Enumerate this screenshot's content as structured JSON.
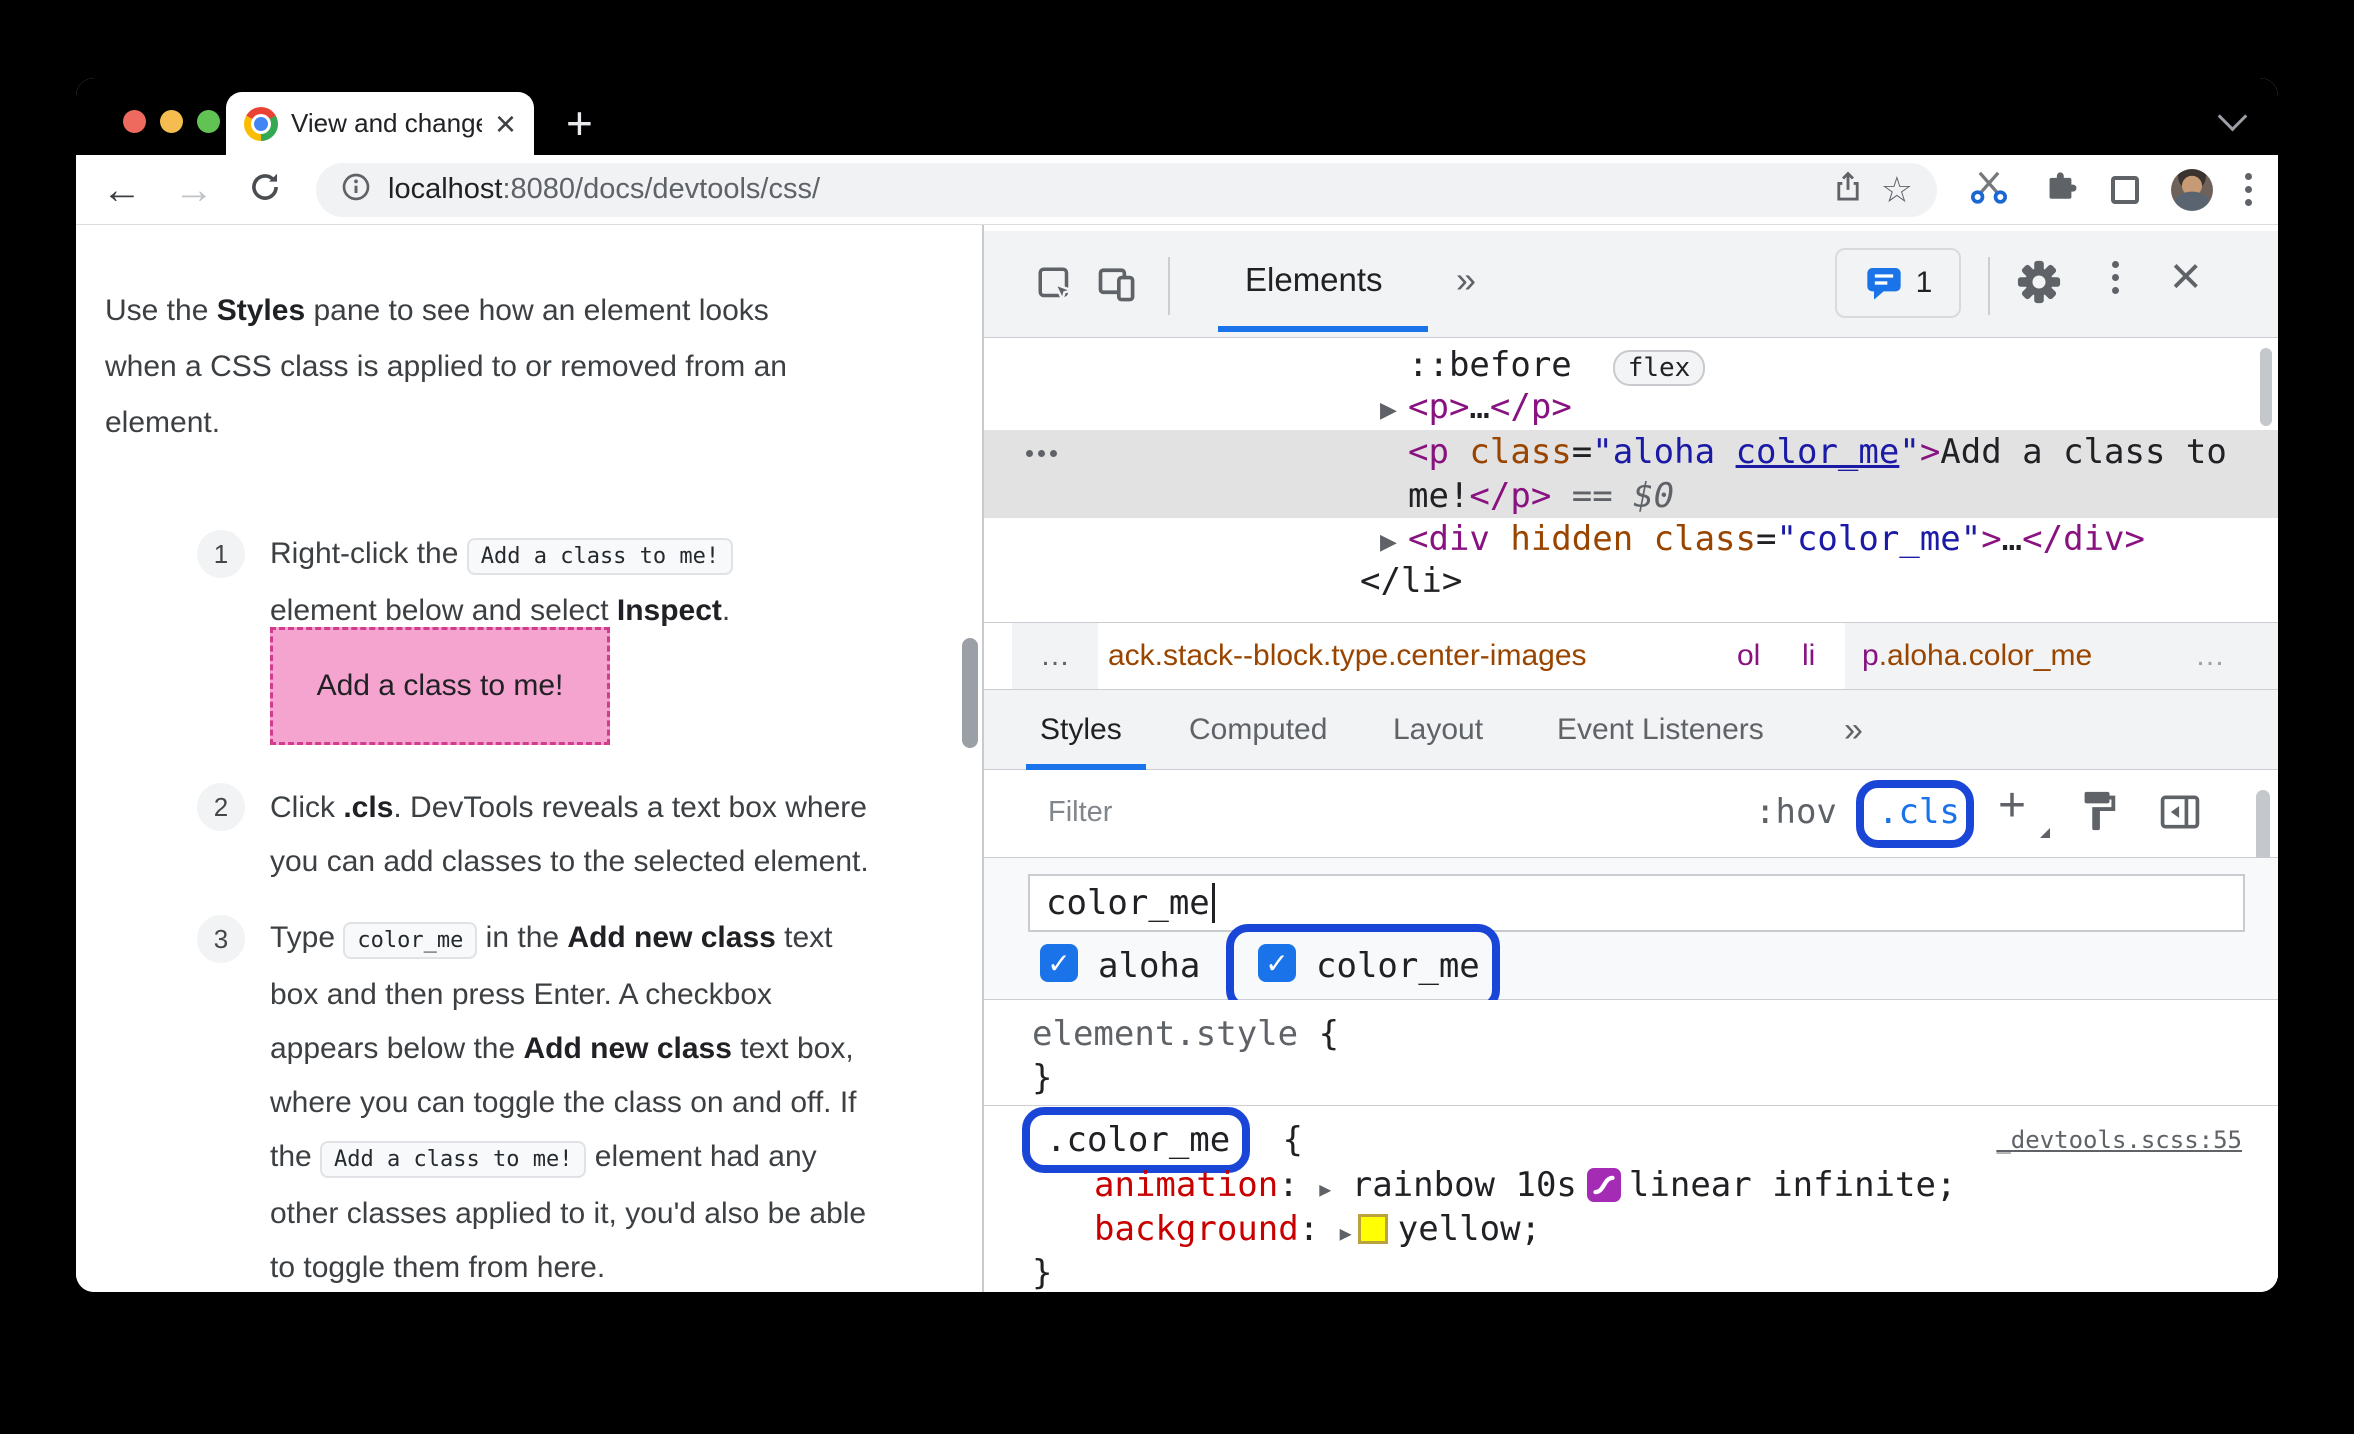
{
  "colors": {
    "annotation_blue": "#1A46D8",
    "devtools_accent_blue": "#1A73E8",
    "selection_gray": "#E2E2E2",
    "tag_purple": "#881280",
    "attr_orange": "#994500",
    "value_blue": "#1A1AA6",
    "property_red": "#C80000",
    "demo_pink_bg": "#F5A3CF",
    "demo_pink_border": "#D23C8E",
    "swatch_yellow": "#FFFF00",
    "bezier_purple": "#A42CB5"
  },
  "glyphs": {
    "back": "←",
    "forward": "→",
    "star": "☆",
    "plus": "+",
    "close": "×",
    "more": "»",
    "arrow": "▶",
    "check": "✓",
    "ellipsis": "…"
  },
  "browser": {
    "tab_title": "View and change CSS - Chrome",
    "url_host": "localhost",
    "url_path": ":8080/docs/devtools/css/"
  },
  "doc": {
    "intro": {
      "a": "Use the ",
      "b": "Styles",
      "c": " pane to see how an element looks",
      "d": "when a CSS class is applied to or removed from an",
      "e": "element."
    },
    "step1": {
      "num": "1",
      "a": "Right-click the ",
      "code": "Add a class to me!",
      "b": "element below and select ",
      "bold": "Inspect",
      "c": "."
    },
    "demo_box": "Add a class to me!",
    "step2": {
      "num": "2",
      "a": "Click ",
      "bold": ".cls",
      "b": ". DevTools reveals a text box where",
      "c": "you can add classes to the selected element."
    },
    "step3": {
      "num": "3",
      "l1a": "Type ",
      "l1code": "color_me",
      "l1b": " in the ",
      "l1bold": "Add new class",
      "l1c": " text",
      "l2": "box and then press Enter. A checkbox",
      "l3a": "appears below the ",
      "l3bold": "Add new class",
      "l3b": " text box,",
      "l4": "where you can toggle the class on and off. If",
      "l5a": "the ",
      "l5code": "Add a class to me!",
      "l5b": " element had any",
      "l6": "other classes applied to it, you'd also be able",
      "l7": "to toggle them from here."
    }
  },
  "devtools": {
    "header": {
      "tab": "Elements",
      "more": "»",
      "issues_count": "1",
      "close": "×"
    },
    "dom": {
      "pseudo": "::before",
      "badge": "flex",
      "p_row": {
        "a": "<p>",
        "b": "…",
        "c": "</p>"
      },
      "sel1": {
        "t1": "<p ",
        "t2": "class",
        "t3": "=",
        "t4": "\"aloha ",
        "t5": "color_me",
        "t6": "\"",
        "t7": ">",
        "t8": "Add a class to"
      },
      "sel2": {
        "t1": "me!",
        "t2": "</p>",
        "t3": " == ",
        "t4": "$0"
      },
      "div_row": {
        "t1": "<div ",
        "t2": "hidden class",
        "t3": "=",
        "t4": "\"color_me\"",
        "t5": ">",
        "t6": "…",
        "t7": "</div>"
      },
      "li_close": "</li>"
    },
    "crumbs": {
      "more_left": "…",
      "c1": "ack.stack--block.type.center-images",
      "c2": "ol",
      "c3": "li",
      "c4a": "p",
      "c4b": ".aloha.color_me",
      "more_right": "…"
    },
    "tabs": {
      "t1": "Styles",
      "t2": "Computed",
      "t3": "Layout",
      "t4": "Event Listeners",
      "more": "»"
    },
    "filter": {
      "placeholder": "Filter",
      "hov": ":hov",
      "cls": ".cls",
      "plus": "+"
    },
    "classes": {
      "input_value": "color_me",
      "cb1": "aloha",
      "cb2": "color_me",
      "check": "✓"
    },
    "rules": {
      "es_sel": "element.style",
      "es_open": " {",
      "es_close": "}",
      "cm_sel": ".color_me",
      "cm_open": " {",
      "cm_link": "_devtools.scss:55",
      "p1n": "animation",
      "p1c": ":",
      "p1v1": "rainbow 10s",
      "p1v2": "linear infinite;",
      "p2n": "background",
      "p2c": ":",
      "p2v": "yellow;",
      "cm_close": "}"
    }
  }
}
